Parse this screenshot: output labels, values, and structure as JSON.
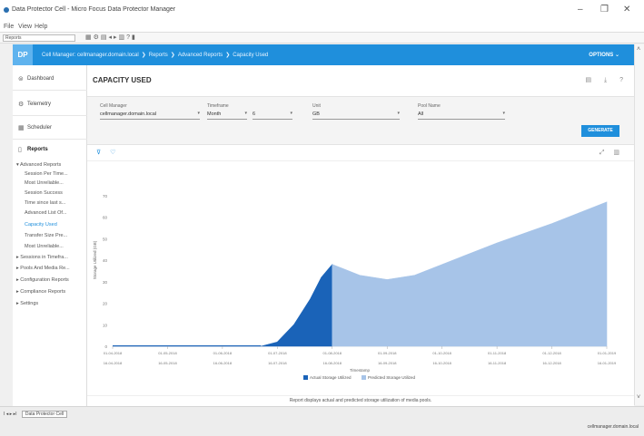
{
  "window": {
    "title": "Data Protector Cell - Micro Focus Data Protector Manager",
    "controls": {
      "minimize": "–",
      "maximize": "❐",
      "close": "✕"
    }
  },
  "menu": {
    "items": [
      "File",
      "View",
      "Help"
    ]
  },
  "toolbar": {
    "context": "Reports"
  },
  "header": {
    "logo": "DP",
    "breadcrumb": [
      "Cell Manager: cellmanager.domain.local",
      "Reports",
      "Advanced Reports",
      "Capacity Used"
    ],
    "options_label": "OPTIONS ⌄"
  },
  "sidebar": {
    "items": [
      {
        "label": "Dashboard",
        "icon": "dashboard-icon"
      },
      {
        "label": "Telemetry",
        "icon": "telemetry-icon"
      },
      {
        "label": "Scheduler",
        "icon": "scheduler-icon"
      },
      {
        "label": "Reports",
        "icon": "reports-icon"
      }
    ],
    "tree": [
      "▾ Advanced Reports",
      "Session Per Time...",
      "Most Unreliable...",
      "Session Success",
      "Time since last s...",
      "Advanced List Of...",
      "Capacity Used",
      "Transfer Size Pre...",
      "Most Unreliable...",
      "▸ Sessions in Timefra...",
      "▸ Pools And Media Re...",
      "▸ Configuration Reports",
      "▸ Compliance Reports",
      "▸ Settings"
    ]
  },
  "main": {
    "title": "CAPACITY USED",
    "top_icons": "▤ ⤓ ?",
    "filters": {
      "cell_manager": {
        "label": "Cell Manager",
        "value": "cellmanager.domain.local"
      },
      "timeframe": {
        "label": "Timeframe",
        "value": "Month",
        "count": "6"
      },
      "unit": {
        "label": "Unit",
        "value": "GB"
      },
      "pool_name": {
        "label": "Pool Name",
        "value": "All"
      }
    },
    "generate_label": "GENERATE",
    "chart_tools_left": "⊽ ♡",
    "chart_tools_right": "⤢ ▥",
    "footer_message": "Report displays actual and predicted storage utilization of media pools."
  },
  "chart_data": {
    "type": "area",
    "xlabel": "Timestamp",
    "ylabel": "Storage Utilized (GB)",
    "ylim": [
      0,
      80
    ],
    "yticks": [
      0,
      10,
      20,
      30,
      40,
      50,
      60,
      70
    ],
    "x_top": [
      "01-04-2018",
      "01-05-2018",
      "01-06-2018",
      "01-07-2018",
      "01-08-2018",
      "01-09-2018",
      "01-10-2018",
      "01-11-2018",
      "01-12-2018",
      "01-01-2019"
    ],
    "x_bottom": [
      "16-04-2018",
      "16-05-2018",
      "16-06-2018",
      "16-07-2018",
      "16-08-2018",
      "16-09-2018",
      "16-10-2018",
      "16-11-2018",
      "16-12-2018",
      "16-01-2019"
    ],
    "series": [
      {
        "name": "Actual Storage Utilized",
        "color": "#1a63b8",
        "x": [
          0,
          1,
          2,
          2.7,
          3.0,
          3.3,
          3.6,
          3.8,
          4.0
        ],
        "values": [
          0,
          0,
          0,
          0,
          2,
          10,
          22,
          32,
          38
        ]
      },
      {
        "name": "Predicted Storage Utilized",
        "color": "#a7c4e8",
        "x": [
          4.0,
          4.5,
          5.0,
          5.5,
          6.0,
          7.0,
          8.0,
          9.0
        ],
        "values": [
          38,
          33,
          31,
          33,
          38,
          48,
          57,
          67
        ]
      }
    ],
    "legend": "bottom",
    "grid": false
  },
  "status": {
    "tabs": [
      "I ◂ ▸ ▸I",
      "Data Protector Cell"
    ],
    "user": "cellmanager.domain.local"
  }
}
